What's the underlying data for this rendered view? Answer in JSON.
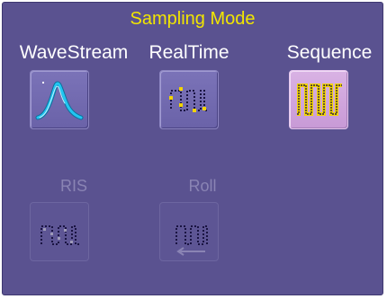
{
  "panel": {
    "title": "Sampling Mode"
  },
  "modes": [
    {
      "label": "WaveStream",
      "icon": "wavestream-waveform-icon",
      "state": "enabled"
    },
    {
      "label": "RealTime",
      "icon": "realtime-squarewave-icon",
      "state": "enabled"
    },
    {
      "label": "Sequence",
      "icon": "sequence-pulses-icon",
      "state": "selected"
    },
    {
      "label": "RIS",
      "icon": "ris-squarewave-icon",
      "state": "disabled"
    },
    {
      "label": "Roll",
      "icon": "roll-squarewave-icon",
      "state": "disabled"
    }
  ],
  "colors": {
    "panel_background": "#5a5290",
    "title_text": "#f2e600",
    "label_text": "#ffffff",
    "disabled_label_text": "#8a84b4",
    "selected_button": "#d9b2e4",
    "wavestream_trace": "#22c6f2",
    "trace_marker": "#f2d400"
  }
}
